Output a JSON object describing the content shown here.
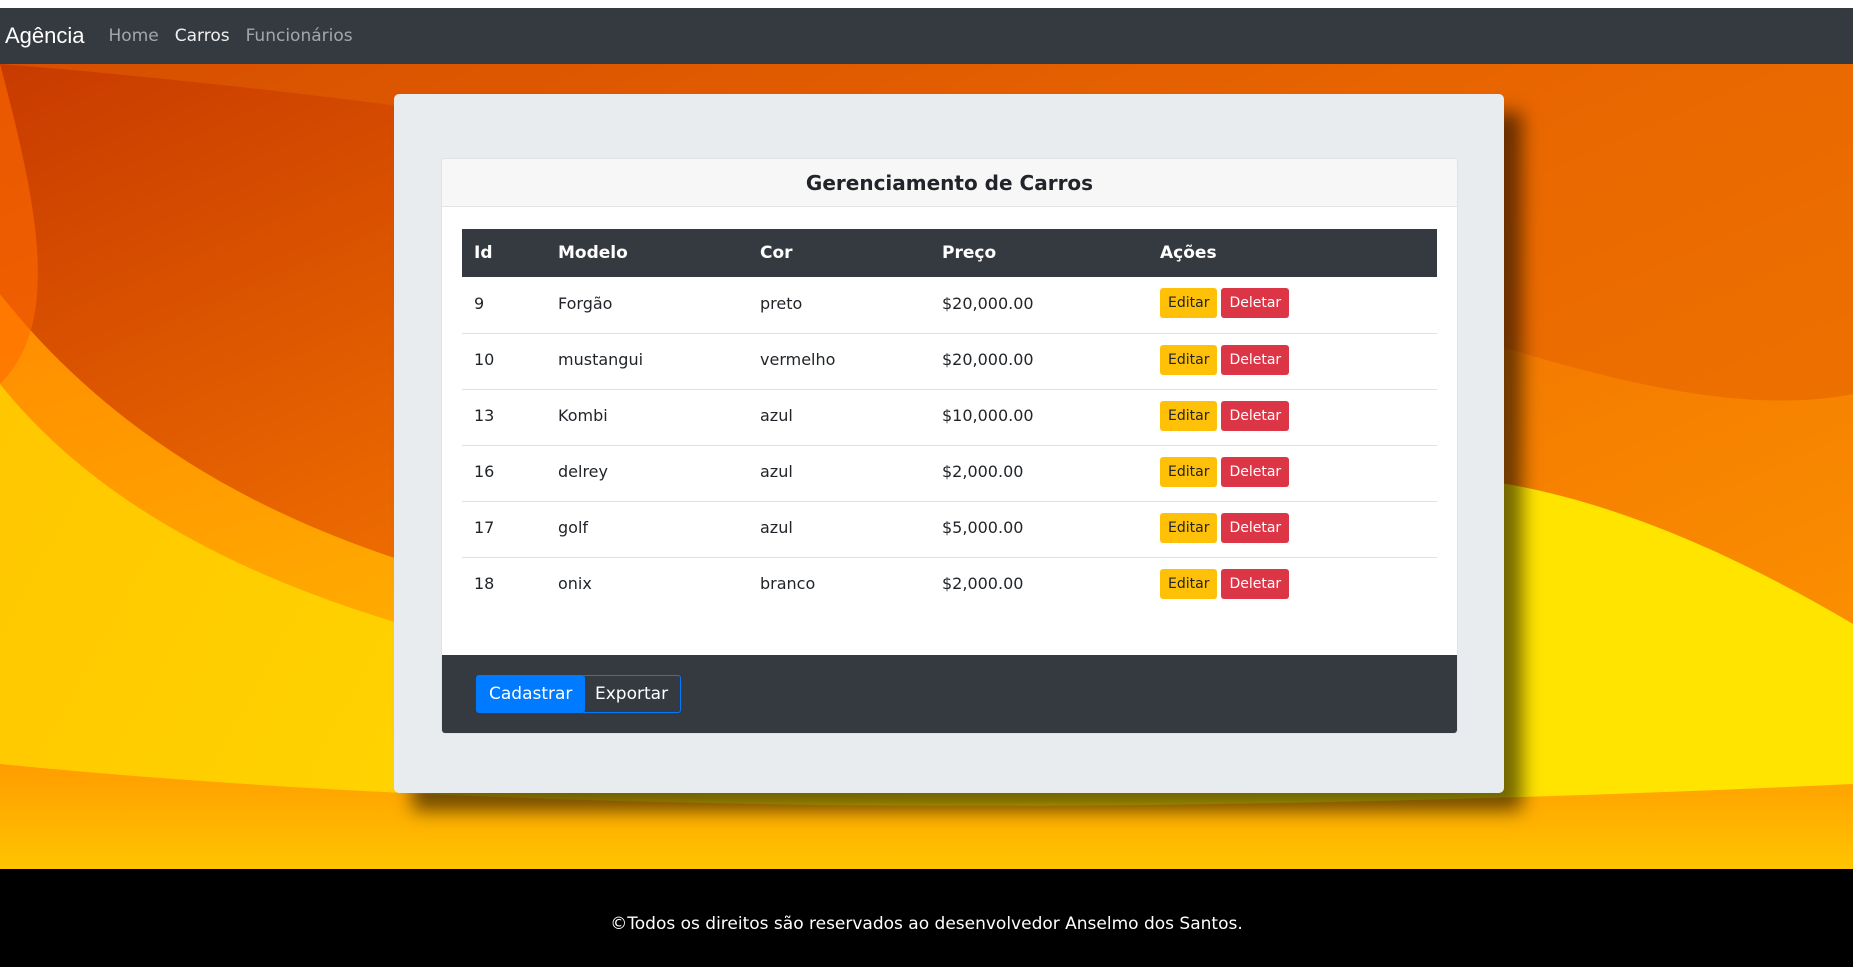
{
  "navbar": {
    "brand": "Agência",
    "links": [
      {
        "label": "Home",
        "active": false
      },
      {
        "label": "Carros",
        "active": true
      },
      {
        "label": "Funcionários",
        "active": false
      }
    ]
  },
  "card": {
    "title": "Gerenciamento de Carros",
    "columns": [
      "Id",
      "Modelo",
      "Cor",
      "Preço",
      "Ações"
    ],
    "rows": [
      {
        "id": "9",
        "modelo": "Forgão",
        "cor": "preto",
        "preco": "$20,000.00"
      },
      {
        "id": "10",
        "modelo": "mustangui",
        "cor": "vermelho",
        "preco": "$20,000.00"
      },
      {
        "id": "13",
        "modelo": "Kombi",
        "cor": "azul",
        "preco": "$10,000.00"
      },
      {
        "id": "16",
        "modelo": "delrey",
        "cor": "azul",
        "preco": "$2,000.00"
      },
      {
        "id": "17",
        "modelo": "golf",
        "cor": "azul",
        "preco": "$5,000.00"
      },
      {
        "id": "18",
        "modelo": "onix",
        "cor": "branco",
        "preco": "$2,000.00"
      }
    ],
    "edit_label": "Editar",
    "delete_label": "Deletar",
    "footer": {
      "cadastrar_label": "Cadastrar",
      "exportar_label": "Exportar"
    }
  },
  "footer": {
    "text": "©Todos os direitos são reservados ao desenvolvedor Anselmo dos Santos."
  },
  "colors": {
    "navbar": "#343a40",
    "edit": "#ffc107",
    "delete": "#dc3545",
    "primary": "#007bff",
    "background_orange": "#f18b00",
    "background_yellow": "#ffe600"
  }
}
